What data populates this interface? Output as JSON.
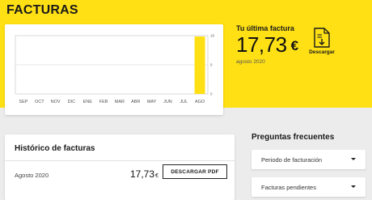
{
  "page": {
    "title": "FACTURAS"
  },
  "chart_data": {
    "type": "bar",
    "categories": [
      "SEP",
      "OCT",
      "NOV",
      "DIC",
      "ENE",
      "FEB",
      "MAR",
      "ABR",
      "MAY",
      "JUN",
      "JUL",
      "AGO"
    ],
    "values": [
      0,
      0,
      0,
      0,
      0,
      0,
      0,
      0,
      0,
      0,
      0,
      17.73
    ],
    "yticks": [
      0,
      9,
      18
    ],
    "ylim": [
      0,
      18
    ],
    "bar_color": "#ffe014",
    "grid": true
  },
  "latest_invoice": {
    "label": "Tu última factura",
    "amount": "17,73",
    "currency": "€",
    "date": "agosto 2020",
    "download_label": "Descargar",
    "download_icon": "document-download-icon"
  },
  "history": {
    "title": "Histórico de facturas",
    "rows": [
      {
        "period": "Agosto 2020",
        "amount": "17,73",
        "currency": "€",
        "button_label": "DESCARGAR PDF"
      }
    ]
  },
  "faq": {
    "title": "Preguntas frecuentes",
    "items": [
      {
        "label": "Periodo de facturación",
        "icon": "caret-down-icon"
      },
      {
        "label": "Facturas pendientes",
        "icon": "caret-down-icon"
      }
    ]
  },
  "colors": {
    "accent": "#ffe014",
    "background": "#ececec",
    "text": "#1a1a1a"
  }
}
